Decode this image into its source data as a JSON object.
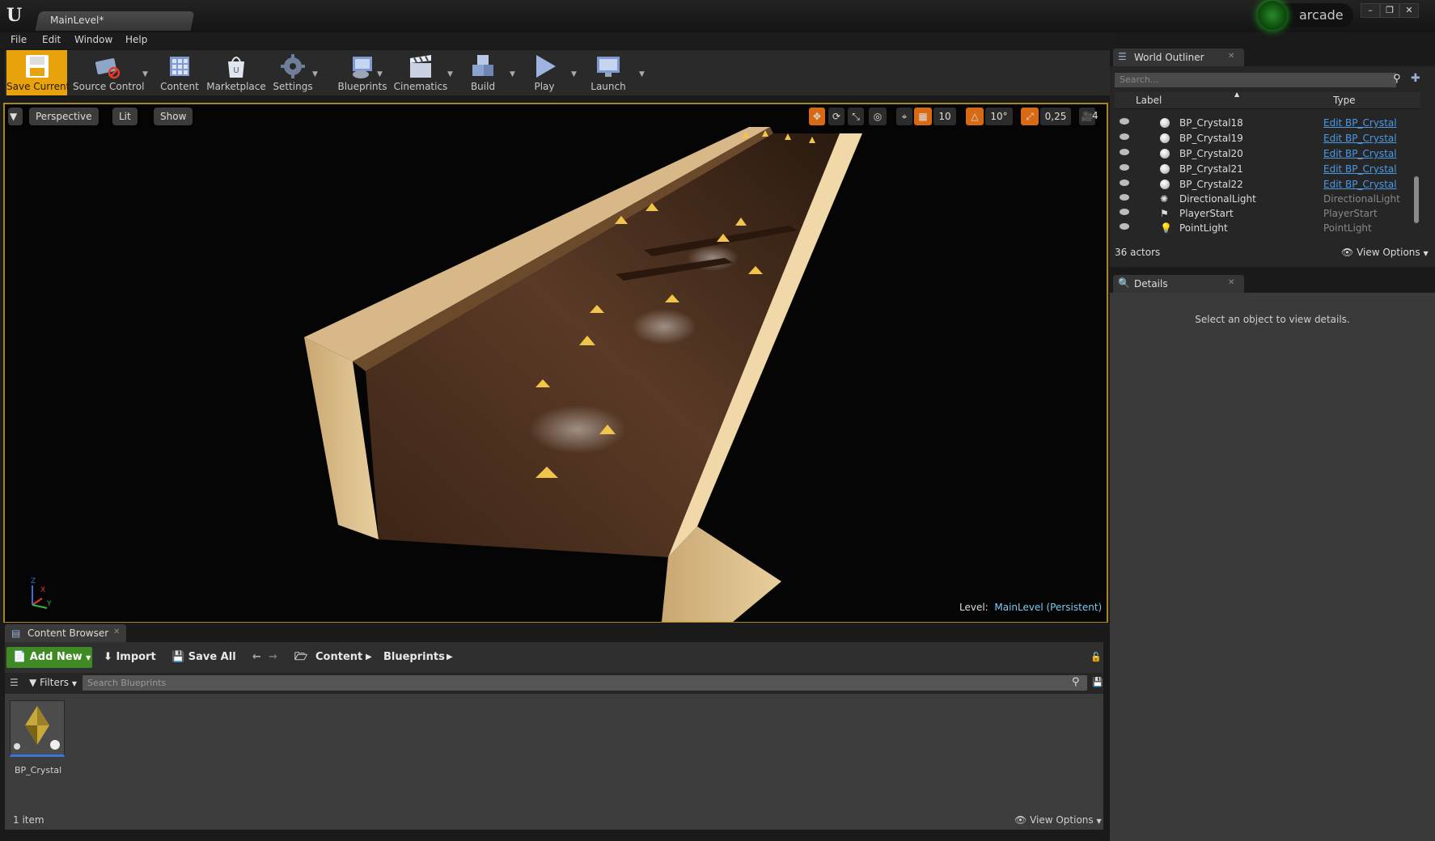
{
  "window": {
    "doc_tab": "MainLevel*",
    "arcade_label": "arcade",
    "minimize": "–",
    "maximize": "❐",
    "close": "✕"
  },
  "menu": [
    "File",
    "Edit",
    "Window",
    "Help"
  ],
  "toolbar": [
    {
      "label": "Save Current"
    },
    {
      "label": "Source Control"
    },
    {
      "label": "Content"
    },
    {
      "label": "Marketplace"
    },
    {
      "label": "Settings"
    },
    {
      "label": "Blueprints"
    },
    {
      "label": "Cinematics"
    },
    {
      "label": "Build"
    },
    {
      "label": "Play"
    },
    {
      "label": "Launch"
    }
  ],
  "viewport": {
    "perspective": "Perspective",
    "lit": "Lit",
    "show": "Show",
    "grid_snap": "10",
    "rot_snap": "10°",
    "scale_snap": "0,25",
    "cam_speed": "4",
    "level_prefix": "Level:",
    "level_name": "MainLevel (Persistent)",
    "axis_x": "X",
    "axis_y": "Y",
    "axis_z": "Z"
  },
  "content_browser": {
    "tab": "Content Browser",
    "add_new": "Add New",
    "import": "Import",
    "save_all": "Save All",
    "path": [
      "Content",
      "Blueprints"
    ],
    "filters": "Filters",
    "search_placeholder": "Search Blueprints",
    "asset": "BP_Crystal",
    "count": "1 item",
    "view_options": "View Options"
  },
  "world_outliner": {
    "tab": "World Outliner",
    "search_placeholder": "Search...",
    "col_label": "Label",
    "col_type": "Type",
    "rows": [
      {
        "label": "BP_Crystal18",
        "type": "Edit BP_Crystal"
      },
      {
        "label": "BP_Crystal19",
        "type": "Edit BP_Crystal"
      },
      {
        "label": "BP_Crystal20",
        "type": "Edit BP_Crystal"
      },
      {
        "label": "BP_Crystal21",
        "type": "Edit BP_Crystal"
      },
      {
        "label": "BP_Crystal22",
        "type": "Edit BP_Crystal"
      },
      {
        "label": "DirectionalLight",
        "type": "DirectionalLight"
      },
      {
        "label": "PlayerStart",
        "type": "PlayerStart"
      },
      {
        "label": "PointLight",
        "type": "PointLight"
      }
    ],
    "count": "36 actors",
    "view_options": "View Options"
  },
  "details": {
    "tab": "Details",
    "message": "Select an object to view details."
  }
}
